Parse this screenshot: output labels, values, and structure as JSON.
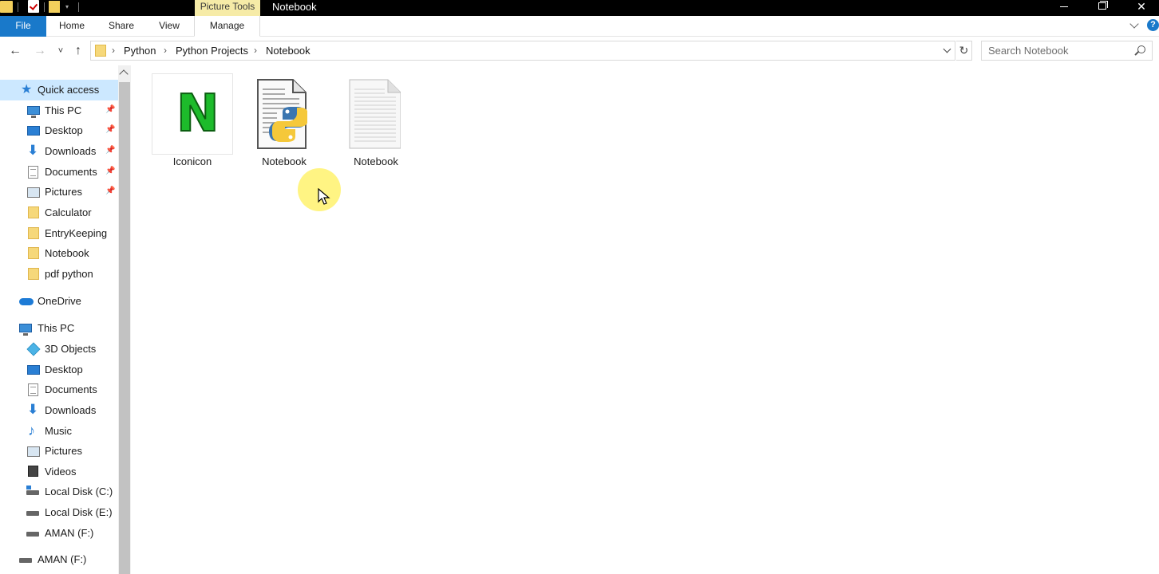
{
  "window": {
    "context_tab": "Picture Tools",
    "title": "Notebook",
    "minimize_label": "",
    "maximize_label": "",
    "close_label": "✕"
  },
  "ribbon": {
    "tabs": [
      {
        "label": "File"
      },
      {
        "label": "Home"
      },
      {
        "label": "Share"
      },
      {
        "label": "View"
      },
      {
        "label": "Manage"
      }
    ],
    "help_label": "?"
  },
  "address": {
    "back_icon": "←",
    "forward_icon": "→",
    "recent_icon": "˅",
    "up_icon": "↑",
    "breadcrumbs": [
      "Python",
      "Python Projects",
      "Notebook"
    ],
    "separator": "›",
    "refresh_icon": "↻"
  },
  "search": {
    "placeholder": "Search Notebook",
    "value": ""
  },
  "nav": {
    "quick_access": {
      "label": "Quick access",
      "items": [
        {
          "label": "This PC",
          "icon": "monitor-icon",
          "pinned": true
        },
        {
          "label": "Desktop",
          "icon": "desktop-icon",
          "pinned": true
        },
        {
          "label": "Downloads",
          "icon": "downloads-icon",
          "pinned": true
        },
        {
          "label": "Documents",
          "icon": "documents-icon",
          "pinned": true
        },
        {
          "label": "Pictures",
          "icon": "pictures-icon",
          "pinned": true
        },
        {
          "label": "Calculator",
          "icon": "folder-icon",
          "pinned": false
        },
        {
          "label": "EntryKeeping",
          "icon": "folder-icon",
          "pinned": false
        },
        {
          "label": "Notebook",
          "icon": "folder-icon",
          "pinned": false
        },
        {
          "label": "pdf python",
          "icon": "folder-icon",
          "pinned": false
        }
      ]
    },
    "onedrive": {
      "label": "OneDrive"
    },
    "this_pc": {
      "label": "This PC",
      "items": [
        {
          "label": "3D Objects",
          "icon": "3d-objects-icon"
        },
        {
          "label": "Desktop",
          "icon": "desktop-icon"
        },
        {
          "label": "Documents",
          "icon": "documents-icon"
        },
        {
          "label": "Downloads",
          "icon": "downloads-icon"
        },
        {
          "label": "Music",
          "icon": "music-icon"
        },
        {
          "label": "Pictures",
          "icon": "pictures-icon"
        },
        {
          "label": "Videos",
          "icon": "videos-icon"
        },
        {
          "label": "Local Disk (C:)",
          "icon": "disk-icon"
        },
        {
          "label": "Local Disk (E:)",
          "icon": "disk-icon"
        },
        {
          "label": "AMAN (F:)",
          "icon": "disk-icon"
        }
      ]
    },
    "drive_root": {
      "label": "AMAN (F:)"
    }
  },
  "files": [
    {
      "name": "Iconicon",
      "icon": "image-n-icon",
      "glyph": "N",
      "selected": true
    },
    {
      "name": "Notebook",
      "icon": "python-file-icon",
      "selected": false
    },
    {
      "name": "Notebook",
      "icon": "text-file-icon",
      "selected": false
    }
  ],
  "colors": {
    "accent": "#1979ca",
    "selection": "#cce8ff",
    "picture_tools": "#f6eba7",
    "folder": "#f6d87a"
  }
}
